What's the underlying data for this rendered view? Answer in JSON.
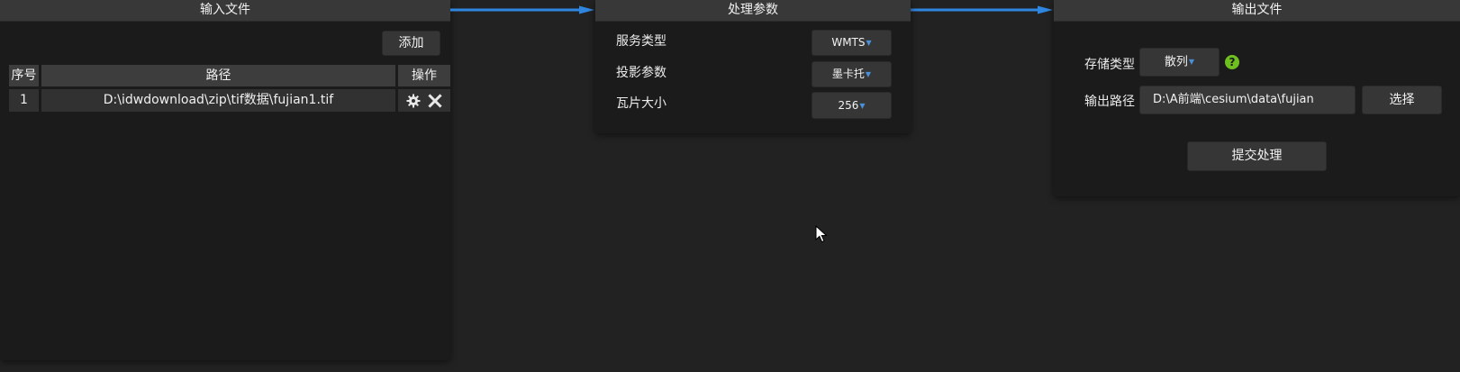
{
  "input_panel": {
    "title": "输入文件",
    "add_button": "添加",
    "table": {
      "headers": [
        "序号",
        "路径",
        "操作"
      ],
      "rows": [
        {
          "index": "1",
          "path": "D:\\idwdownload\\zip\\tif数据\\fujian1.tif"
        }
      ],
      "row_action_icons": [
        "gear-icon",
        "close-icon"
      ]
    }
  },
  "params_panel": {
    "title": "处理参数",
    "fields": [
      {
        "label": "服务类型",
        "value": "WMTS"
      },
      {
        "label": "投影参数",
        "value": "墨卡托"
      },
      {
        "label": "瓦片大小",
        "value": "256"
      }
    ]
  },
  "output_panel": {
    "title": "输出文件",
    "storage_label": "存储类型",
    "storage_value": "散列",
    "help_icon": "?",
    "path_label": "输出路径",
    "path_value": "D:\\A前端\\cesium\\data\\fujian",
    "choose_button": "选择",
    "submit_button": "提交处理"
  },
  "colors": {
    "background": "#222222",
    "panel": "#1b1b1b",
    "header": "#383838",
    "arrow": "#2f86e0",
    "help": "#6fbf20"
  }
}
